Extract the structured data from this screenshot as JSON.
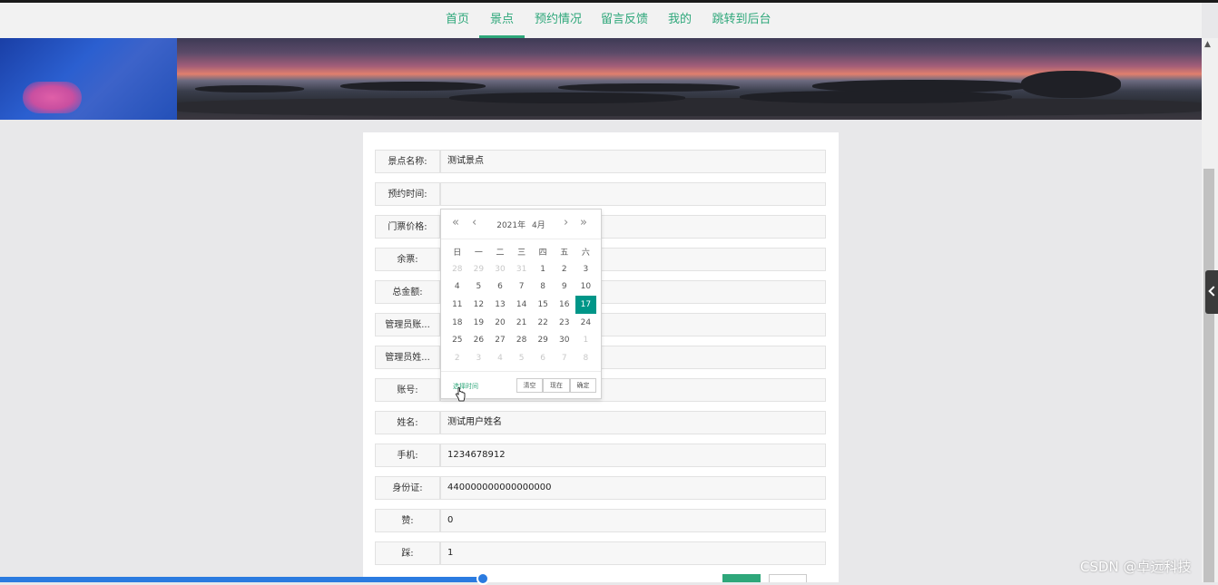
{
  "nav": {
    "items": [
      {
        "label": "首页"
      },
      {
        "label": "景点",
        "active": true
      },
      {
        "label": "预约情况"
      },
      {
        "label": "留言反馈"
      },
      {
        "label": "我的"
      },
      {
        "label": "跳转到后台"
      }
    ]
  },
  "form": {
    "fields": [
      {
        "label": "景点名称:",
        "value": "测试景点"
      },
      {
        "label": "预约时间:",
        "value": ""
      },
      {
        "label": "门票价格:",
        "value": ""
      },
      {
        "label": "余票:",
        "value": ""
      },
      {
        "label": "总金额:",
        "value": ""
      },
      {
        "label": "管理员账...",
        "value": ""
      },
      {
        "label": "管理员姓...",
        "value": ""
      },
      {
        "label": "账号:",
        "value": ""
      },
      {
        "label": "姓名:",
        "value": "测试用户姓名"
      },
      {
        "label": "手机:",
        "value": "1234678912"
      },
      {
        "label": "身份证:",
        "value": "440000000000000000"
      },
      {
        "label": "赞:",
        "value": "0"
      },
      {
        "label": "踩:",
        "value": "1"
      }
    ]
  },
  "datepicker": {
    "year": "2021年",
    "month": "4月",
    "weekdays": [
      "日",
      "一",
      "二",
      "三",
      "四",
      "五",
      "六"
    ],
    "weeks": [
      [
        {
          "d": "28",
          "m": 1
        },
        {
          "d": "29",
          "m": 1
        },
        {
          "d": "30",
          "m": 1
        },
        {
          "d": "31",
          "m": 1
        },
        {
          "d": "1"
        },
        {
          "d": "2"
        },
        {
          "d": "3"
        }
      ],
      [
        {
          "d": "4"
        },
        {
          "d": "5"
        },
        {
          "d": "6"
        },
        {
          "d": "7"
        },
        {
          "d": "8"
        },
        {
          "d": "9"
        },
        {
          "d": "10"
        }
      ],
      [
        {
          "d": "11"
        },
        {
          "d": "12"
        },
        {
          "d": "13"
        },
        {
          "d": "14"
        },
        {
          "d": "15"
        },
        {
          "d": "16"
        },
        {
          "d": "17",
          "s": 1
        }
      ],
      [
        {
          "d": "18"
        },
        {
          "d": "19"
        },
        {
          "d": "20"
        },
        {
          "d": "21"
        },
        {
          "d": "22"
        },
        {
          "d": "23"
        },
        {
          "d": "24"
        }
      ],
      [
        {
          "d": "25"
        },
        {
          "d": "26"
        },
        {
          "d": "27"
        },
        {
          "d": "28"
        },
        {
          "d": "29"
        },
        {
          "d": "30"
        },
        {
          "d": "1",
          "m": 1
        }
      ],
      [
        {
          "d": "2",
          "m": 1
        },
        {
          "d": "3",
          "m": 1
        },
        {
          "d": "4",
          "m": 1
        },
        {
          "d": "5",
          "m": 1
        },
        {
          "d": "6",
          "m": 1
        },
        {
          "d": "7",
          "m": 1
        },
        {
          "d": "8",
          "m": 1
        }
      ]
    ],
    "select_time": "选择时间",
    "clear": "清空",
    "now": "现在",
    "confirm": "确定"
  },
  "colors": {
    "accent": "#2ea77a",
    "selected_day": "#009688",
    "progress": "#2b7be0"
  },
  "watermark": "CSDN @卓远科技"
}
